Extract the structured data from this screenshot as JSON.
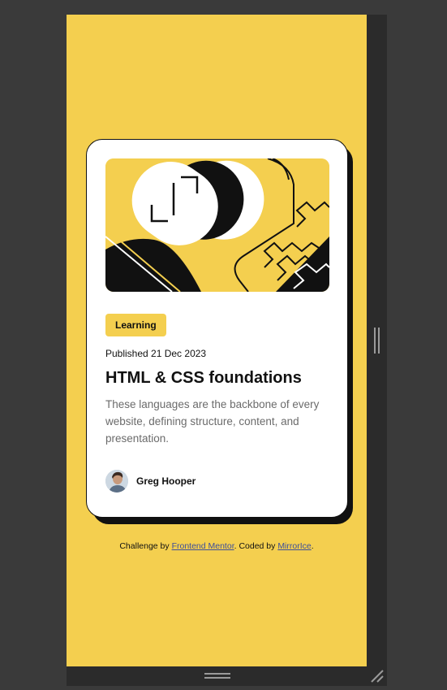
{
  "card": {
    "tag": "Learning",
    "published": "Published 21 Dec 2023",
    "title": "HTML & CSS foundations",
    "description": "These languages are the backbone of every website, defining structure, content, and presentation.",
    "author": "Greg Hooper"
  },
  "attribution": {
    "prefix": "Challenge by ",
    "link1": "Frontend Mentor",
    "middle": ". Coded by ",
    "link2": "MirrorIce",
    "suffix": "."
  },
  "colors": {
    "accent": "#f4cf4f",
    "ink": "#111111",
    "muted": "#6b6b6b",
    "link": "#3d4f9b",
    "chrome": "#3a3a3a"
  }
}
